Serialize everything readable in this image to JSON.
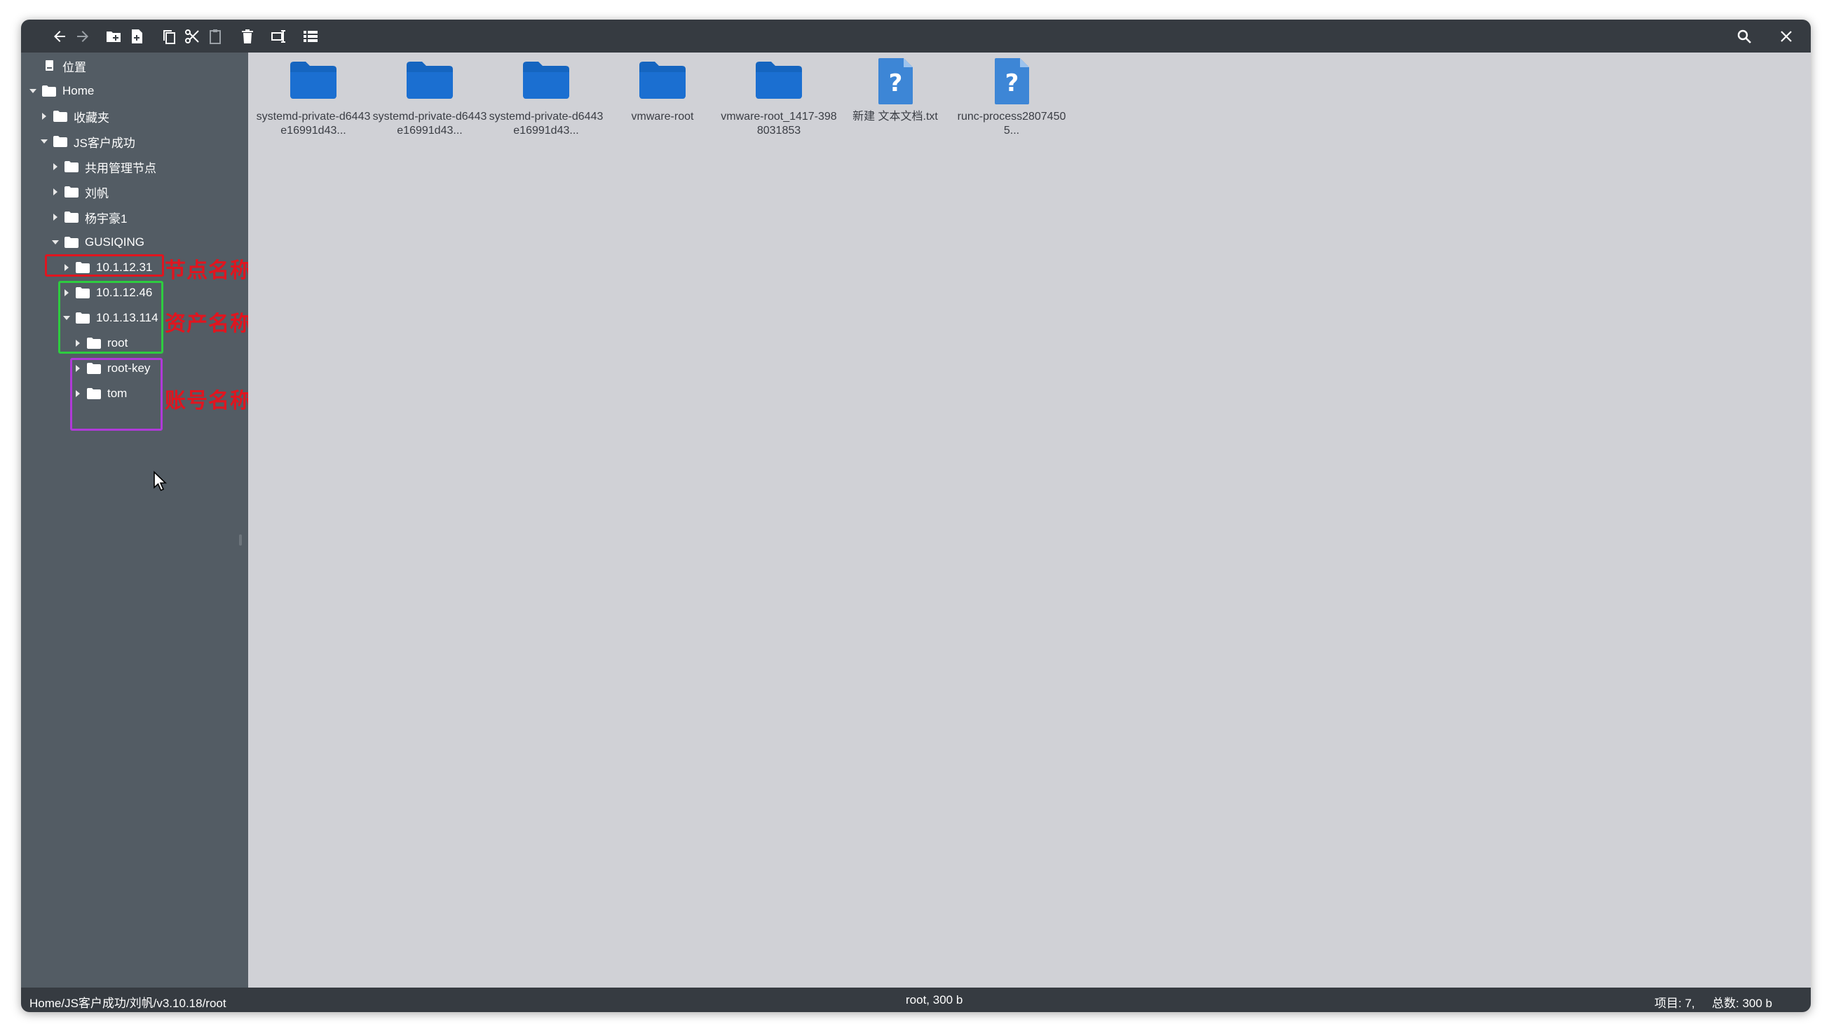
{
  "toolbar": {
    "buttons": [
      "back-icon",
      "forward-icon",
      "new-folder-icon",
      "new-file-icon",
      "copy-icon",
      "cut-icon",
      "paste-icon",
      "delete-icon",
      "rename-icon",
      "list-view-icon"
    ],
    "right_buttons": [
      "search-icon",
      "close-icon"
    ]
  },
  "sidebar": {
    "items": [
      {
        "label": "位置",
        "icon": "location-icon"
      },
      {
        "label": "Home",
        "icon": "folder-icon",
        "expanded": true
      },
      {
        "label": "收藏夹",
        "icon": "folder-icon",
        "expanded": false
      },
      {
        "label": "JS客户成功",
        "icon": "folder-icon",
        "expanded": true
      },
      {
        "label": "共用管理节点",
        "icon": "folder-icon",
        "expanded": false
      },
      {
        "label": "刘帆",
        "icon": "folder-icon",
        "expanded": false
      },
      {
        "label": "杨宇豪1",
        "icon": "folder-icon",
        "expanded": false
      },
      {
        "label": "GUSIQING",
        "icon": "folder-icon",
        "expanded": true
      },
      {
        "label": "10.1.12.31",
        "icon": "folder-icon",
        "expanded": false
      },
      {
        "label": "10.1.12.46",
        "icon": "folder-icon",
        "expanded": false
      },
      {
        "label": "10.1.13.114",
        "icon": "folder-icon",
        "expanded": true
      },
      {
        "label": "root",
        "icon": "folder-icon",
        "expanded": false
      },
      {
        "label": "root-key",
        "icon": "folder-icon",
        "expanded": false
      },
      {
        "label": "tom",
        "icon": "folder-icon",
        "expanded": false
      }
    ]
  },
  "annotations": {
    "node": {
      "text": "节点名称",
      "color": "#e0151f"
    },
    "asset": {
      "text": "资产名称",
      "color": "#2ecc40"
    },
    "account": {
      "text": "账号名称",
      "color": "#b03ad8"
    }
  },
  "files": [
    {
      "name": "systemd-private-d6443e16991d43...",
      "type": "folder"
    },
    {
      "name": "systemd-private-d6443e16991d43...",
      "type": "folder"
    },
    {
      "name": "systemd-private-d6443e16991d43...",
      "type": "folder"
    },
    {
      "name": "vmware-root",
      "type": "folder"
    },
    {
      "name": "vmware-root_1417-3988031853",
      "type": "folder"
    },
    {
      "name": "新建 文本文档.txt",
      "type": "unknown"
    },
    {
      "name": "runc-process28074505...",
      "type": "unknown"
    }
  ],
  "statusbar": {
    "path": "Home/JS客户成功/刘帆/v3.10.18/root",
    "selection": "root, 300 b",
    "items": "项目: 7,",
    "total": "总数: 300 b"
  },
  "colors": {
    "toolbar_bg": "#363b41",
    "sidebar_bg": "#535c64",
    "main_bg": "#d0d1d6",
    "folder_blue": "#1565c0",
    "annot_red": "#e0151f",
    "annot_green": "#2ecc40",
    "annot_purple": "#b03ad8"
  }
}
